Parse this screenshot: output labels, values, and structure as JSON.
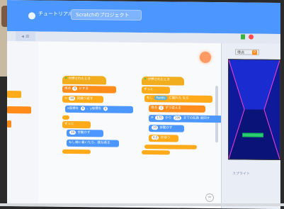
{
  "menubar": {
    "tutorial_label": "チュートリアル",
    "project_title": "Scratchのプロジェクト"
  },
  "tabs": {
    "code": ""
  },
  "workspace": {
    "script1": {
      "hat": "が押されたとき",
      "set_var": [
        "得点 ",
        " を ",
        "0",
        " にする"
      ],
      "repeat": [
        "",
        "10",
        " 回繰り返す"
      ],
      "goto": [
        "x座標を ",
        "0",
        " 、y座標を ",
        "0",
        " にする"
      ],
      "forever": "ずっと",
      "move": [
        "",
        "10",
        " 歩動かす"
      ],
      "bounce": "もし端に着いたら、跳ね返る"
    },
    "script2": {
      "hat": "が押されたとき",
      "forever": "ずっと",
      "if": [
        "もし ",
        "Paddle",
        " に触れた ",
        "なら"
      ],
      "change_var": [
        "得点 ",
        " を ",
        "1",
        " ずつ変える"
      ],
      "turn": [
        "",
        "170",
        " から ",
        "190",
        " までの乱数 ",
        "度回す"
      ],
      "move": [
        "",
        "10",
        " 歩動かす"
      ],
      "wait": [
        "",
        "0.5",
        " 秒待つ"
      ]
    }
  },
  "stage": {
    "var_name": "得点",
    "var_value": "0"
  },
  "sprite_panel": {
    "label": "スプライト"
  },
  "colors": {
    "menubar": "#4c97ff",
    "events": "#ffbf00",
    "control": "#ffab19",
    "variables": "#ff8c1a",
    "motion": "#4c97ff",
    "sensing": "#5cb1d6",
    "stage_bg": "#0e1a9a"
  }
}
